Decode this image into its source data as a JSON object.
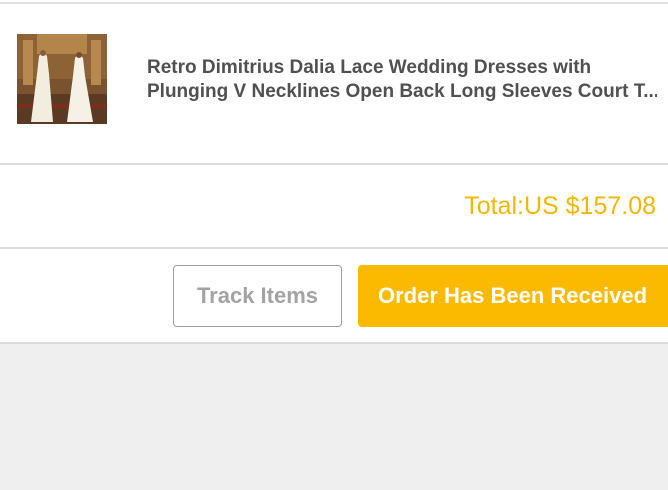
{
  "order": {
    "product": {
      "title_line1": "Retro Dimitrius Dalia Lace Wedding Dresses with",
      "title_line2": "Plunging V Necklines Open Back Long Sleeves Court T..."
    },
    "total_label": "Total:US $157.08"
  },
  "actions": {
    "track_label": "Track Items",
    "received_label": "Order Has Been Received"
  },
  "colors": {
    "accent": "#fbb900",
    "total_text": "#f2b705"
  }
}
